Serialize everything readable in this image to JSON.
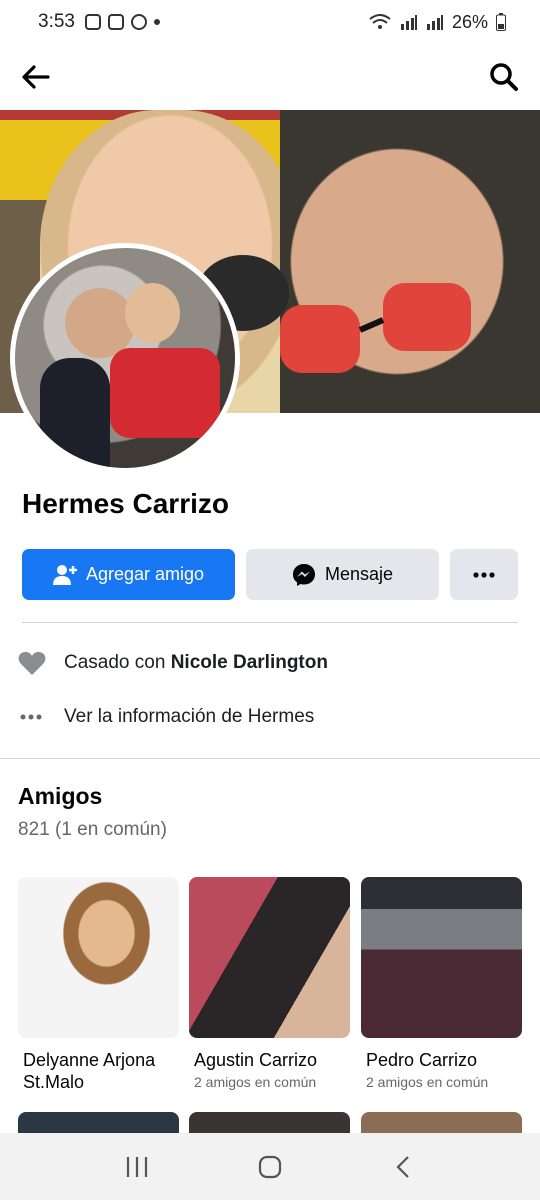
{
  "status_bar": {
    "time": "3:53",
    "battery": "26%"
  },
  "profile": {
    "name": "Hermes Carrizo"
  },
  "actions": {
    "add_friend": "Agregar amigo",
    "message": "Mensaje"
  },
  "info": {
    "relationship_prefix": "Casado con",
    "relationship_partner": "Nicole Darlington",
    "see_info": "Ver la información de Hermes"
  },
  "friends": {
    "title": "Amigos",
    "count": "821 (1 en común)",
    "items": [
      {
        "name": "Delyanne Arjona St.Malo",
        "mutual": ""
      },
      {
        "name": "Agustin Carrizo",
        "mutual": "2 amigos en común"
      },
      {
        "name": "Pedro Carrizo",
        "mutual": "2 amigos en común"
      }
    ]
  },
  "colors": {
    "primary": "#1877f2",
    "secondary_bg": "#e4e6eb",
    "muted_text": "#65676b"
  }
}
